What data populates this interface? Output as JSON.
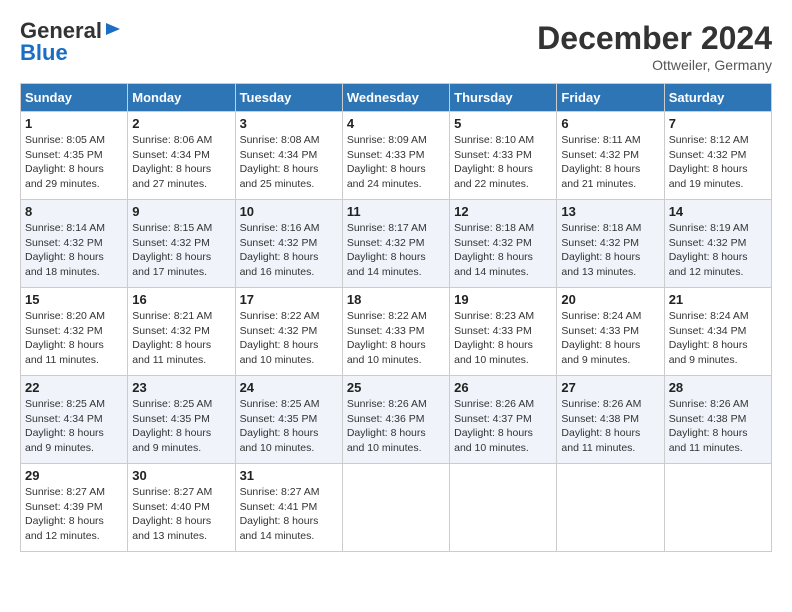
{
  "header": {
    "logo_general": "General",
    "logo_blue": "Blue",
    "month_title": "December 2024",
    "location": "Ottweiler, Germany"
  },
  "weekdays": [
    "Sunday",
    "Monday",
    "Tuesday",
    "Wednesday",
    "Thursday",
    "Friday",
    "Saturday"
  ],
  "weeks": [
    [
      {
        "day": "1",
        "sunrise": "Sunrise: 8:05 AM",
        "sunset": "Sunset: 4:35 PM",
        "daylight": "Daylight: 8 hours and 29 minutes."
      },
      {
        "day": "2",
        "sunrise": "Sunrise: 8:06 AM",
        "sunset": "Sunset: 4:34 PM",
        "daylight": "Daylight: 8 hours and 27 minutes."
      },
      {
        "day": "3",
        "sunrise": "Sunrise: 8:08 AM",
        "sunset": "Sunset: 4:34 PM",
        "daylight": "Daylight: 8 hours and 25 minutes."
      },
      {
        "day": "4",
        "sunrise": "Sunrise: 8:09 AM",
        "sunset": "Sunset: 4:33 PM",
        "daylight": "Daylight: 8 hours and 24 minutes."
      },
      {
        "day": "5",
        "sunrise": "Sunrise: 8:10 AM",
        "sunset": "Sunset: 4:33 PM",
        "daylight": "Daylight: 8 hours and 22 minutes."
      },
      {
        "day": "6",
        "sunrise": "Sunrise: 8:11 AM",
        "sunset": "Sunset: 4:32 PM",
        "daylight": "Daylight: 8 hours and 21 minutes."
      },
      {
        "day": "7",
        "sunrise": "Sunrise: 8:12 AM",
        "sunset": "Sunset: 4:32 PM",
        "daylight": "Daylight: 8 hours and 19 minutes."
      }
    ],
    [
      {
        "day": "8",
        "sunrise": "Sunrise: 8:14 AM",
        "sunset": "Sunset: 4:32 PM",
        "daylight": "Daylight: 8 hours and 18 minutes."
      },
      {
        "day": "9",
        "sunrise": "Sunrise: 8:15 AM",
        "sunset": "Sunset: 4:32 PM",
        "daylight": "Daylight: 8 hours and 17 minutes."
      },
      {
        "day": "10",
        "sunrise": "Sunrise: 8:16 AM",
        "sunset": "Sunset: 4:32 PM",
        "daylight": "Daylight: 8 hours and 16 minutes."
      },
      {
        "day": "11",
        "sunrise": "Sunrise: 8:17 AM",
        "sunset": "Sunset: 4:32 PM",
        "daylight": "Daylight: 8 hours and 14 minutes."
      },
      {
        "day": "12",
        "sunrise": "Sunrise: 8:18 AM",
        "sunset": "Sunset: 4:32 PM",
        "daylight": "Daylight: 8 hours and 14 minutes."
      },
      {
        "day": "13",
        "sunrise": "Sunrise: 8:18 AM",
        "sunset": "Sunset: 4:32 PM",
        "daylight": "Daylight: 8 hours and 13 minutes."
      },
      {
        "day": "14",
        "sunrise": "Sunrise: 8:19 AM",
        "sunset": "Sunset: 4:32 PM",
        "daylight": "Daylight: 8 hours and 12 minutes."
      }
    ],
    [
      {
        "day": "15",
        "sunrise": "Sunrise: 8:20 AM",
        "sunset": "Sunset: 4:32 PM",
        "daylight": "Daylight: 8 hours and 11 minutes."
      },
      {
        "day": "16",
        "sunrise": "Sunrise: 8:21 AM",
        "sunset": "Sunset: 4:32 PM",
        "daylight": "Daylight: 8 hours and 11 minutes."
      },
      {
        "day": "17",
        "sunrise": "Sunrise: 8:22 AM",
        "sunset": "Sunset: 4:32 PM",
        "daylight": "Daylight: 8 hours and 10 minutes."
      },
      {
        "day": "18",
        "sunrise": "Sunrise: 8:22 AM",
        "sunset": "Sunset: 4:33 PM",
        "daylight": "Daylight: 8 hours and 10 minutes."
      },
      {
        "day": "19",
        "sunrise": "Sunrise: 8:23 AM",
        "sunset": "Sunset: 4:33 PM",
        "daylight": "Daylight: 8 hours and 10 minutes."
      },
      {
        "day": "20",
        "sunrise": "Sunrise: 8:24 AM",
        "sunset": "Sunset: 4:33 PM",
        "daylight": "Daylight: 8 hours and 9 minutes."
      },
      {
        "day": "21",
        "sunrise": "Sunrise: 8:24 AM",
        "sunset": "Sunset: 4:34 PM",
        "daylight": "Daylight: 8 hours and 9 minutes."
      }
    ],
    [
      {
        "day": "22",
        "sunrise": "Sunrise: 8:25 AM",
        "sunset": "Sunset: 4:34 PM",
        "daylight": "Daylight: 8 hours and 9 minutes."
      },
      {
        "day": "23",
        "sunrise": "Sunrise: 8:25 AM",
        "sunset": "Sunset: 4:35 PM",
        "daylight": "Daylight: 8 hours and 9 minutes."
      },
      {
        "day": "24",
        "sunrise": "Sunrise: 8:25 AM",
        "sunset": "Sunset: 4:35 PM",
        "daylight": "Daylight: 8 hours and 10 minutes."
      },
      {
        "day": "25",
        "sunrise": "Sunrise: 8:26 AM",
        "sunset": "Sunset: 4:36 PM",
        "daylight": "Daylight: 8 hours and 10 minutes."
      },
      {
        "day": "26",
        "sunrise": "Sunrise: 8:26 AM",
        "sunset": "Sunset: 4:37 PM",
        "daylight": "Daylight: 8 hours and 10 minutes."
      },
      {
        "day": "27",
        "sunrise": "Sunrise: 8:26 AM",
        "sunset": "Sunset: 4:38 PM",
        "daylight": "Daylight: 8 hours and 11 minutes."
      },
      {
        "day": "28",
        "sunrise": "Sunrise: 8:26 AM",
        "sunset": "Sunset: 4:38 PM",
        "daylight": "Daylight: 8 hours and 11 minutes."
      }
    ],
    [
      {
        "day": "29",
        "sunrise": "Sunrise: 8:27 AM",
        "sunset": "Sunset: 4:39 PM",
        "daylight": "Daylight: 8 hours and 12 minutes."
      },
      {
        "day": "30",
        "sunrise": "Sunrise: 8:27 AM",
        "sunset": "Sunset: 4:40 PM",
        "daylight": "Daylight: 8 hours and 13 minutes."
      },
      {
        "day": "31",
        "sunrise": "Sunrise: 8:27 AM",
        "sunset": "Sunset: 4:41 PM",
        "daylight": "Daylight: 8 hours and 14 minutes."
      },
      null,
      null,
      null,
      null
    ]
  ]
}
